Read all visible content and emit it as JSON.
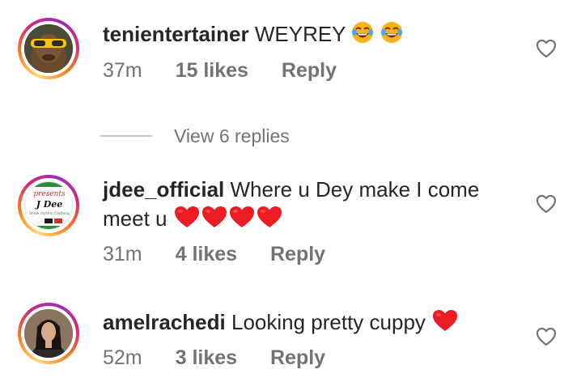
{
  "comments": [
    {
      "username": "tenientertainer",
      "text": "WEYREY",
      "emojis": [
        "face-with-tears-of-joy",
        "face-with-tears-of-joy"
      ],
      "time": "37m",
      "likes": "15 likes",
      "reply": "Reply"
    },
    {
      "username": "jdee_official",
      "text_line1": "Where u Dey make I come",
      "text_line2": "meet u",
      "emojis": [
        "red-heart",
        "red-heart",
        "red-heart",
        "red-heart"
      ],
      "avatar_text": {
        "top": "presents",
        "name": "J Dee",
        "sub": "Show rhythm Clothing"
      },
      "time": "31m",
      "likes": "4 likes",
      "reply": "Reply"
    },
    {
      "username": "amelrachedi",
      "text": "Looking pretty cuppy",
      "emojis": [
        "red-heart"
      ],
      "time": "52m",
      "likes": "3 likes",
      "reply": "Reply"
    }
  ],
  "view_replies": "View 6 replies",
  "icons": {
    "like": "heart-outline-icon"
  },
  "colors": {
    "text": "#262626",
    "secondary": "#737373",
    "heart": "#ed1c24"
  }
}
